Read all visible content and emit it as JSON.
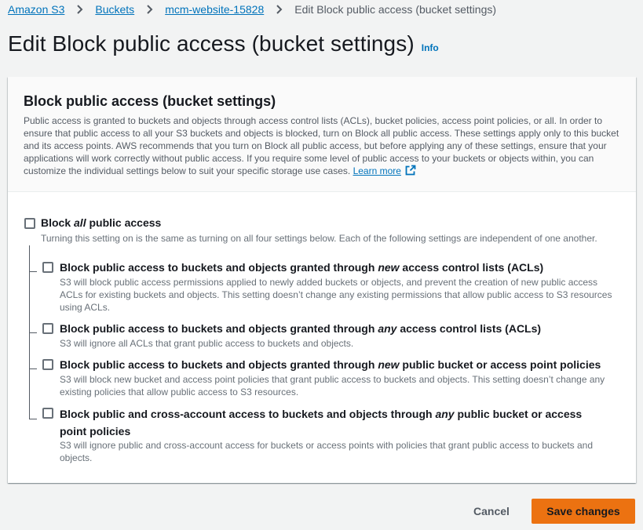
{
  "breadcrumb": {
    "items": [
      "Amazon S3",
      "Buckets",
      "mcm-website-15828"
    ],
    "current": "Edit Block public access (bucket settings)"
  },
  "page": {
    "title": "Edit Block public access (bucket settings)",
    "info": "Info"
  },
  "panel": {
    "heading": "Block public access (bucket settings)",
    "description": "Public access is granted to buckets and objects through access control lists (ACLs), bucket policies, access point policies, or all. In order to ensure that public access to all your S3 buckets and objects is blocked, turn on Block all public access. These settings apply only to this bucket and its access points. AWS recommends that you turn on Block all public access, but before applying any of these settings, ensure that your applications will work correctly without public access. If you require some level of public access to your buckets or objects within, you can customize the individual settings below to suit your specific storage use cases.",
    "learn_more": "Learn more"
  },
  "settings": {
    "block_all": {
      "label_pre": "Block ",
      "label_em": "all",
      "label_post": " public access",
      "checked": false,
      "description": "Turning this setting on is the same as turning on all four settings below. Each of the following settings are independent of one another."
    },
    "options": [
      {
        "label_pre": "Block public access to buckets and objects granted through ",
        "label_em": "new",
        "label_post": " access control lists (ACLs)",
        "checked": false,
        "description": "S3 will block public access permissions applied to newly added buckets or objects, and prevent the creation of new public access ACLs for existing buckets and objects. This setting doesn’t change any existing permissions that allow public access to S3 resources using ACLs."
      },
      {
        "label_pre": "Block public access to buckets and objects granted through ",
        "label_em": "any",
        "label_post": " access control lists (ACLs)",
        "checked": false,
        "description": "S3 will ignore all ACLs that grant public access to buckets and objects."
      },
      {
        "label_pre": "Block public access to buckets and objects granted through ",
        "label_em": "new",
        "label_post": " public bucket or access point policies",
        "checked": false,
        "description": "S3 will block new bucket and access point policies that grant public access to buckets and objects. This setting doesn’t change any existing policies that allow public access to S3 resources."
      },
      {
        "label_pre": "Block public and cross-account access to buckets and objects through ",
        "label_em": "any",
        "label_post": " public bucket or access point policies",
        "checked": false,
        "description": "S3 will ignore public and cross-account access for buckets or access points with policies that grant public access to buckets and objects."
      }
    ]
  },
  "footer": {
    "cancel": "Cancel",
    "save": "Save changes"
  },
  "colors": {
    "link": "#0073bb",
    "primary_button": "#ec7211",
    "background": "#f2f3f3"
  }
}
